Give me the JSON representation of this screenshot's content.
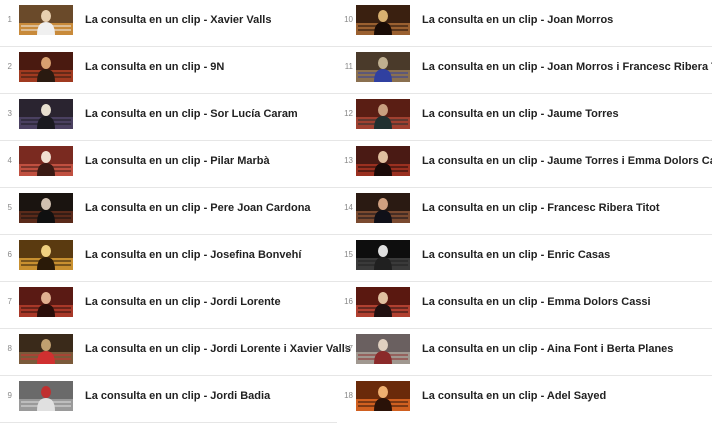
{
  "playlist": {
    "left": [
      {
        "num": "1",
        "title": "La consulta en un clip - Xavier Valls",
        "thumb": "man-white-hair-portrait"
      },
      {
        "num": "2",
        "title": "La consulta en un clip - 9N",
        "thumb": "theater-interview"
      },
      {
        "num": "3",
        "title": "La consulta en un clip - Sor Lucía Caram",
        "thumb": "nun-bookshelf"
      },
      {
        "num": "4",
        "title": "La consulta en un clip - Pilar Marbà",
        "thumb": "woman-red-chair"
      },
      {
        "num": "5",
        "title": "La consulta en un clip - Pere Joan Cardona",
        "thumb": "man-dark-stage"
      },
      {
        "num": "6",
        "title": "La consulta en un clip - Josefina Bonvehí",
        "thumb": "woman-golden-stage"
      },
      {
        "num": "7",
        "title": "La consulta en un clip - Jordi Lorente",
        "thumb": "man-theater-seats"
      },
      {
        "num": "8",
        "title": "La consulta en un clip - Jordi Lorente i Xavier Valls",
        "thumb": "two-men-stage"
      },
      {
        "num": "9",
        "title": "La consulta en un clip - Jordi Badia",
        "thumb": "man-red-shirt-outdoor"
      }
    ],
    "right": [
      {
        "num": "10",
        "title": "La consulta en un clip - Joan Morros",
        "thumb": "man-ornate-hall"
      },
      {
        "num": "11",
        "title": "La consulta en un clip - Joan Morros i Francesc Ribera Titot",
        "thumb": "two-men-interview"
      },
      {
        "num": "12",
        "title": "La consulta en un clip - Jaume Torres",
        "thumb": "man-theater-seats-2"
      },
      {
        "num": "13",
        "title": "La consulta en un clip - Jaume Torres i Emma Dolors Cassi",
        "thumb": "couple-stage"
      },
      {
        "num": "14",
        "title": "La consulta en un clip - Francesc Ribera Titot",
        "thumb": "man-closeup"
      },
      {
        "num": "15",
        "title": "La consulta en un clip - Enric Casas",
        "thumb": "man-dark-room"
      },
      {
        "num": "16",
        "title": "La consulta en un clip - Emma Dolors Cassi",
        "thumb": "woman-theater-seats"
      },
      {
        "num": "17",
        "title": "La consulta en un clip - Aina Font i Berta Planes",
        "thumb": "two-women-stage"
      },
      {
        "num": "18",
        "title": "La consulta en un clip - Adel Sayed",
        "thumb": "man-orange-stage"
      }
    ]
  },
  "colors": {
    "title_text": "#222222",
    "number_text": "#888888",
    "divider": "#e6e6e6"
  }
}
